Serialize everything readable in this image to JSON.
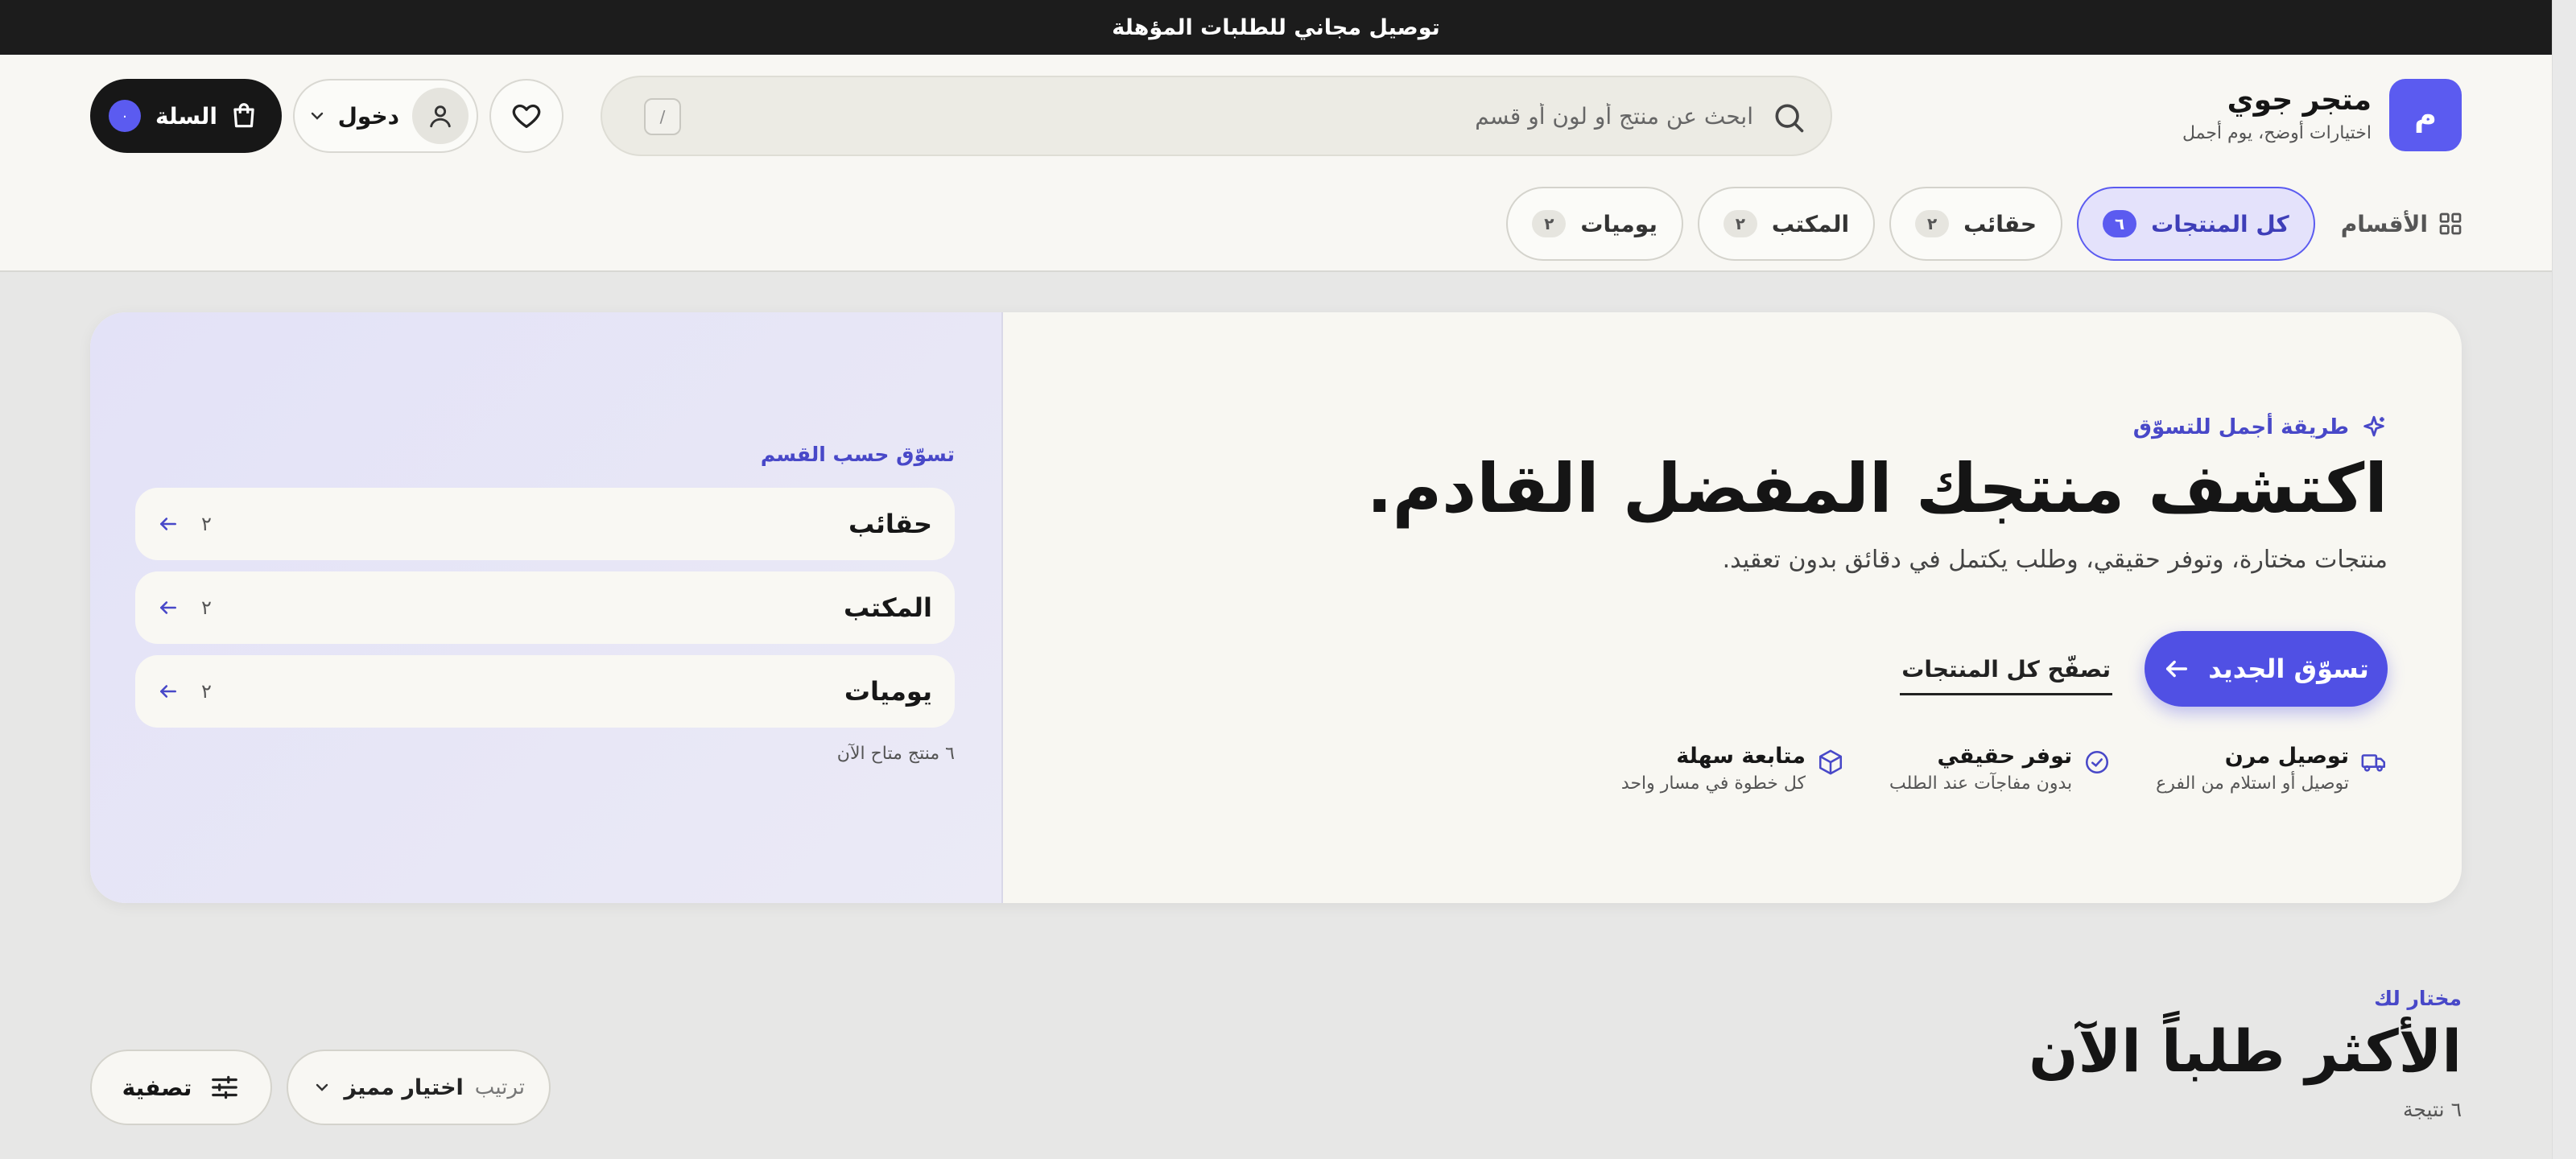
{
  "announcement": "توصيل مجاني للطلبات المؤهلة",
  "brand": {
    "logo_letter": "م",
    "name": "متجر جوي",
    "tagline": "اختيارات أوضح، يوم أجمل"
  },
  "search": {
    "placeholder": "ابحث عن منتج أو لون أو قسم",
    "shortcut": "/"
  },
  "header_actions": {
    "login_label": "دخول",
    "cart_label": "السلة",
    "cart_count": "٠"
  },
  "nav": {
    "categories_label": "الأقسام",
    "chips": [
      {
        "label": "كل المنتجات",
        "count": "٦",
        "active": true
      },
      {
        "label": "حقائب",
        "count": "٢"
      },
      {
        "label": "المكتب",
        "count": "٢"
      },
      {
        "label": "يوميات",
        "count": "٢"
      }
    ]
  },
  "hero": {
    "kicker": "طريقة أجمل للتسوّق",
    "headline": "اكتشف منتجك المفضل القادم.",
    "subline": "منتجات مختارة، وتوفر حقيقي، وطلب يكتمل في دقائق بدون تعقيد.",
    "cta_primary": "تسوّق الجديد",
    "cta_secondary": "تصفّح كل المنتجات",
    "features": [
      {
        "title": "توصيل مرن",
        "sub": "توصيل أو استلام من الفرع",
        "icon": "truck-icon"
      },
      {
        "title": "توفر حقيقي",
        "sub": "بدون مفاجآت عند الطلب",
        "icon": "check-circle-icon"
      },
      {
        "title": "متابعة سهلة",
        "sub": "كل خطوة في مسار واحد",
        "icon": "package-icon"
      }
    ],
    "side": {
      "title": "تسوّق حسب القسم",
      "items": [
        {
          "name": "حقائب",
          "count": "٢"
        },
        {
          "name": "المكتب",
          "count": "٢"
        },
        {
          "name": "يوميات",
          "count": "٢"
        }
      ],
      "footnote": "٦ منتج متاح الآن"
    }
  },
  "section": {
    "kicker": "مختار لك",
    "title": "الأكثر طلباً الآن",
    "count": "٦ نتيجة",
    "filter_label": "تصفية",
    "sort_label": "ترتيب",
    "sort_value": "اختيار مميز"
  },
  "colors": {
    "accent": "#5b5bf0",
    "dark": "#1c1c1c",
    "surface": "#f8f7f3",
    "page_bg": "#e7e7e6"
  }
}
